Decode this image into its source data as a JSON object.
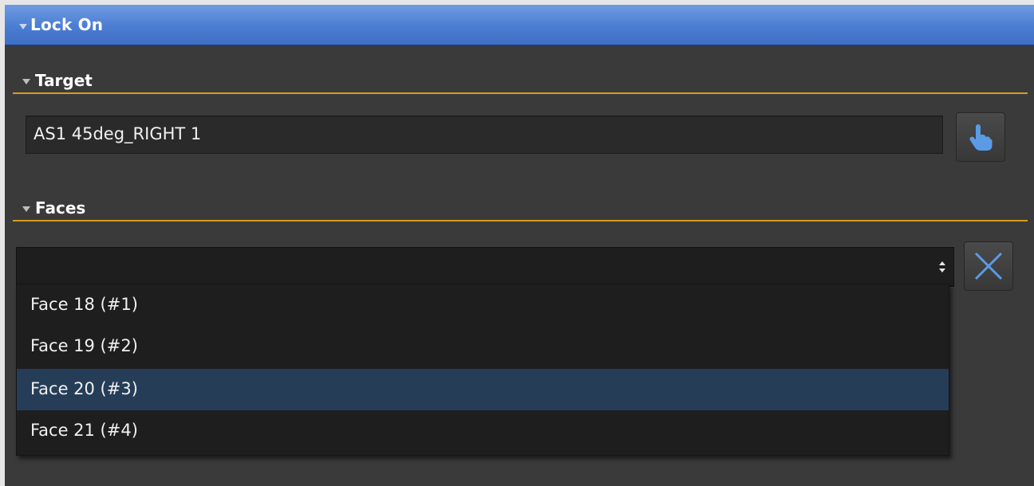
{
  "panel": {
    "title": "Lock On",
    "sections": {
      "target": {
        "label": "Target",
        "value": "AS1 45deg_RIGHT 1"
      },
      "faces": {
        "label": "Faces",
        "selected_value": "",
        "options": [
          "Face 18 (#1)",
          "Face 19 (#2)",
          "Face 20 (#3)",
          "Face 21 (#4)"
        ],
        "highlighted_option": "Face 20 (#3)"
      }
    }
  },
  "icons": {
    "pick": "pointing-hand-icon",
    "clear": "close-x-icon"
  },
  "colors": {
    "titlebar": "#4b7dd2",
    "section_underline": "#d99c1c",
    "highlight": "#263d58",
    "icon_blue": "#5b9be6"
  }
}
